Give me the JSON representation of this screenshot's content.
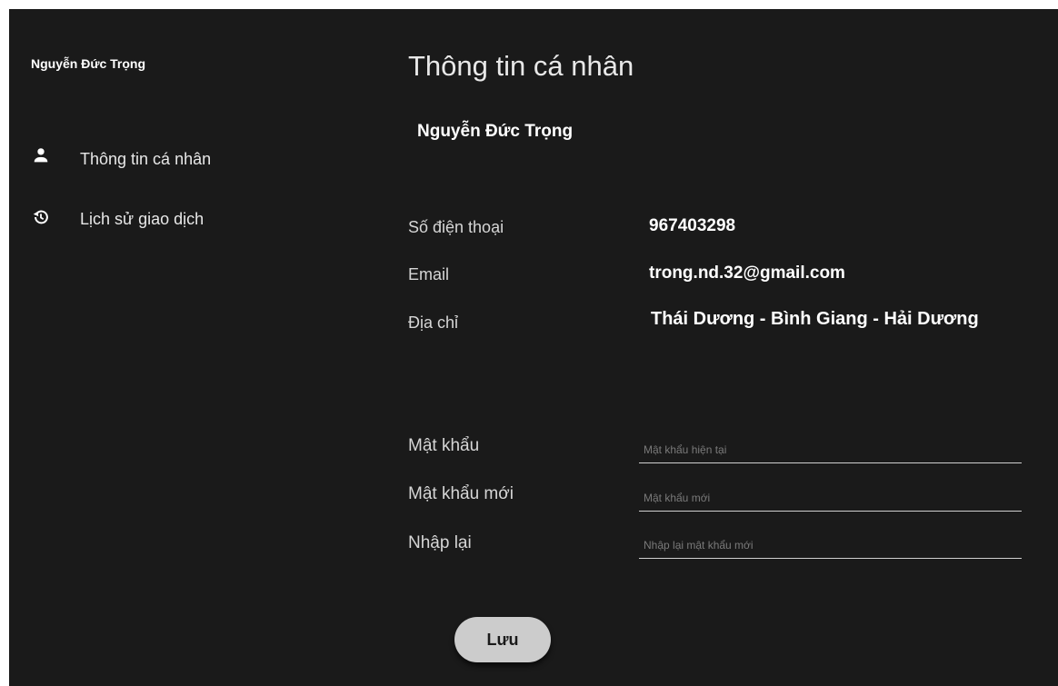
{
  "sidebar": {
    "user_name": "Nguyễn Đức Trọng",
    "items": [
      {
        "label": "Thông tin cá nhân",
        "icon": "person-icon"
      },
      {
        "label": "Lịch sử giao dịch",
        "icon": "history-icon"
      }
    ]
  },
  "main": {
    "title": "Thông tin cá nhân",
    "profile_name": "Nguyễn Đức Trọng",
    "info": {
      "phone_label": "Số điện thoại",
      "phone_value": "967403298",
      "email_label": "Email",
      "email_value": "trong.nd.32@gmail.com",
      "address_label": "Địa chỉ",
      "address_value": "Thái Dương - Bình Giang - Hải Dương"
    },
    "password": {
      "current_label": "Mật khẩu",
      "current_placeholder": "Mật khẩu hiện tại",
      "new_label": "Mật khẩu mới",
      "new_placeholder": "Mật khẩu mới",
      "confirm_label": "Nhập lại",
      "confirm_placeholder": "Nhập lại mật khẩu mới"
    },
    "save_label": "Lưu"
  },
  "colors": {
    "background": "#1a1a1a",
    "text": "#ffffff",
    "button": "#cccccc"
  }
}
